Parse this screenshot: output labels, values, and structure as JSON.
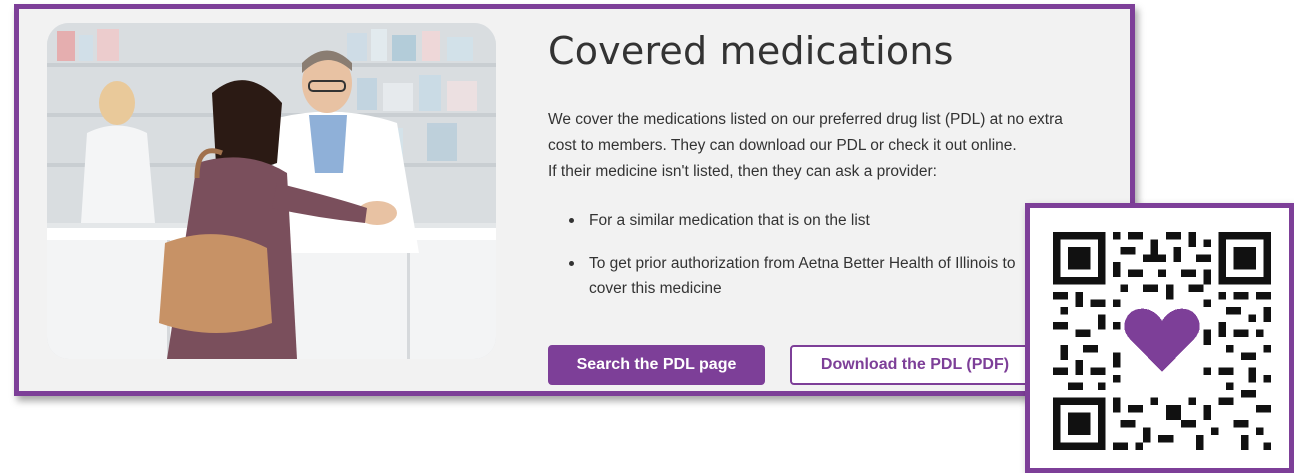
{
  "section": {
    "title": "Covered medications",
    "paragraph_lines": [
      "We cover the medications listed on our preferred drug list (PDL) at no extra",
      "cost to members. They can download our PDL or check it out online.",
      "If their medicine isn't listed, then they can ask a provider:"
    ],
    "bullets": [
      "For a similar medication that is on the list",
      "To get prior authorization from Aetna Better Health of Illinois to cover this medicine"
    ]
  },
  "buttons": {
    "search": "Search the PDL page",
    "download": "Download the PDL (PDF)"
  },
  "photo": {
    "description": "pharmacy-counter-photo"
  },
  "qr": {
    "icon": "heart-icon",
    "accent": "#7d3f98"
  },
  "colors": {
    "brand_purple": "#7d3f98",
    "card_bg": "#f2f2f2",
    "text": "#333333"
  }
}
